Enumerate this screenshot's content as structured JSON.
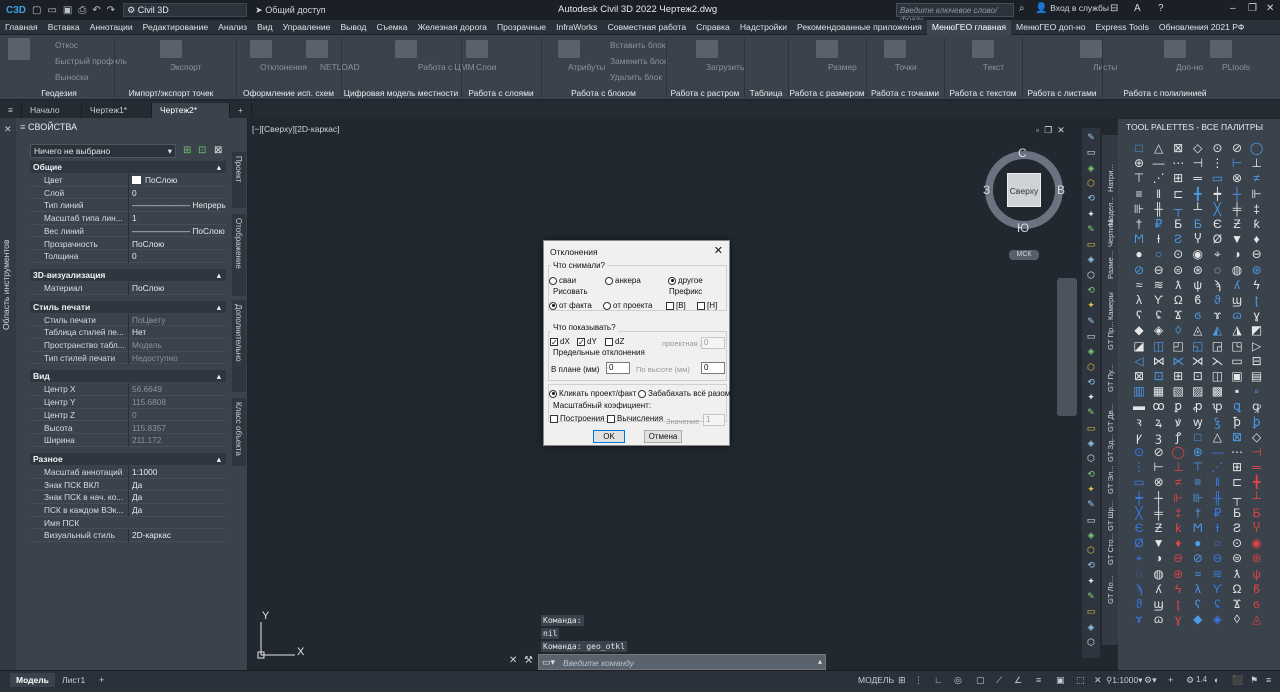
{
  "titlebar": {
    "workspace": "Civil 3D",
    "share": "Общий доступ",
    "app_title": "Autodesk Civil 3D 2022   Чертеж2.dwg",
    "search_placeholder": "Введите ключевое слово/фразу",
    "signin": "Вход в службы"
  },
  "menu": [
    "Главная",
    "Вставка",
    "Аннотации",
    "Редактирование",
    "Анализ",
    "Вид",
    "Управление",
    "Вывод",
    "Съемка",
    "Железная дорога",
    "Прозрачные",
    "InfraWorks",
    "Совместная работа",
    "Справка",
    "Надстройки",
    "Рекомендованные приложения",
    "МенюГЕО главная",
    "МенюГЕО доп-но",
    "Express Tools",
    "Обновления 2021 РФ"
  ],
  "menu_active": "МенюГЕО главная",
  "ribbon": {
    "small_buttons": [
      "Откос",
      "Быстрый профиль",
      "Выноска",
      "Экспорт",
      "Отклонения",
      "NETLOAD",
      "Работа с ЦММ",
      "Слои",
      "Вставить блок",
      "Заменить блок",
      "Удалить блок",
      "Атрибуты",
      "Загрузить",
      "Размер",
      "Точки",
      "Текст",
      "Листы",
      "Доп-но",
      "PLtools"
    ],
    "panels": [
      "Геодезия",
      "Импорт/экспорт точек",
      "Оформление исп. схем",
      "Цифровая модель местности",
      "Работа с слоями",
      "Работа с блоком",
      "Работа с растром",
      "Таблица",
      "Работа с размером",
      "Работа с точками",
      "Работа с текстом",
      "Работа с листами",
      "Работа с полилинией"
    ]
  },
  "doc_tabs": [
    "Начало",
    "Чертеж1*",
    "Чертеж2*"
  ],
  "doc_tab_active": "Чертеж2*",
  "properties": {
    "vertical_label": "Область инструментов",
    "title": "СВОЙСТВА",
    "selection": "Ничего не выбрано",
    "side_tabs": [
      "Проект",
      "Отображение",
      "Дополнительно",
      "Класс объекта"
    ],
    "sections": [
      {
        "name": "Общие",
        "rows": [
          {
            "k": "Цвет",
            "v": "ПоСлою"
          },
          {
            "k": "Слой",
            "v": "0"
          },
          {
            "k": "Тип линий",
            "v": "——————— Непрерыв..."
          },
          {
            "k": "Масштаб типа лин...",
            "v": "1"
          },
          {
            "k": "Вес линий",
            "v": "——————— ПоСлою"
          },
          {
            "k": "Прозрачность",
            "v": "ПоСлою"
          },
          {
            "k": "Толщина",
            "v": "0"
          }
        ]
      },
      {
        "name": "3D-визуализация",
        "rows": [
          {
            "k": "Материал",
            "v": "ПоСлою"
          }
        ]
      },
      {
        "name": "Стиль печати",
        "rows": [
          {
            "k": "Стиль печати",
            "v": "ПоЦвету",
            "dim": true
          },
          {
            "k": "Таблица стилей пе...",
            "v": "Нет"
          },
          {
            "k": "Пространство табл...",
            "v": "Модель",
            "dim": true
          },
          {
            "k": "Тип стилей печати",
            "v": "Недоступно",
            "dim": true
          }
        ]
      },
      {
        "name": "Вид",
        "rows": [
          {
            "k": "Центр X",
            "v": "56.6649",
            "dim": true
          },
          {
            "k": "Центр Y",
            "v": "115.6808",
            "dim": true
          },
          {
            "k": "Центр Z",
            "v": "0",
            "dim": true
          },
          {
            "k": "Высота",
            "v": "115.8357",
            "dim": true
          },
          {
            "k": "Ширина",
            "v": "211.172",
            "dim": true
          }
        ]
      },
      {
        "name": "Разное",
        "rows": [
          {
            "k": "Масштаб аннотаций",
            "v": "1:1000"
          },
          {
            "k": "Знак ПСК ВКЛ",
            "v": "Да"
          },
          {
            "k": "Знак ПСК в нач. ко...",
            "v": "Да"
          },
          {
            "k": "ПСК в каждом ВЭк...",
            "v": "Да"
          },
          {
            "k": "Имя ПСК",
            "v": ""
          },
          {
            "k": "Визуальный стиль",
            "v": "2D-каркас"
          }
        ]
      }
    ]
  },
  "viewport": {
    "label": "[−][Сверху][2D-каркас]",
    "viewcube": {
      "face": "Сверху",
      "n": "С",
      "s": "Ю",
      "w": "З",
      "e": "В",
      "ucs": "МСК"
    },
    "ucs_x": "X",
    "ucs_y": "Y"
  },
  "command": {
    "history": [
      "Команда:",
      "nil",
      "Команда: geo_otkl"
    ],
    "placeholder": "Введите команду"
  },
  "dialog": {
    "title": "Отклонения",
    "group1": "Что снимали?",
    "radios1": [
      {
        "label": "сваи",
        "on": false
      },
      {
        "label": "анкера",
        "on": false
      },
      {
        "label": "другое",
        "on": true
      }
    ],
    "draw_label": "Рисовать",
    "radios2": [
      {
        "label": "от факта",
        "on": true
      },
      {
        "label": "от проекта",
        "on": false
      }
    ],
    "prefix_label": "Префикс",
    "prefix_checks": [
      "[B]",
      "[H]"
    ],
    "group2": "Что показывать?",
    "checks": [
      {
        "label": "dX",
        "on": true
      },
      {
        "label": "dY",
        "on": true
      },
      {
        "label": "dZ",
        "on": false
      }
    ],
    "proj_z_label": "проектная Z (м)",
    "proj_z_value": "0",
    "limits_label": "Предельные отклонения",
    "plan_label": "В плане (мм)",
    "plan_value": "0",
    "height_label": "По высоте (мм)",
    "height_value": "0",
    "radios3": [
      {
        "label": "Кликать проект/факт",
        "on": true
      },
      {
        "label": "Забабахать всё разом",
        "on": false
      }
    ],
    "scale_label": "Масштабный коэфициент:",
    "checks2": [
      {
        "label": "Построения",
        "on": false
      },
      {
        "label": "Вычисления",
        "on": false
      }
    ],
    "value_label": "Значение",
    "value": "1",
    "ok": "OK",
    "cancel": "Отмена"
  },
  "tool_palettes": {
    "title": "TOOL PALETTES - ВСЕ ПАЛИТРЫ",
    "tabs": [
      "Натри...",
      "Модел...",
      "Чертить",
      "Разме...",
      "Камеры",
      "GT Пр...",
      "GT Пу...",
      "GT Дв...",
      "GT Зд...",
      "GT Эл...",
      "GT Шр...",
      "GT Сто...",
      "GT Ло..."
    ]
  },
  "statusbar": {
    "tabs": [
      "Модель",
      "Лист1"
    ],
    "active": "Модель",
    "model_label": "МОДЕЛЬ",
    "scale": "1:1000",
    "zoom": "1.4"
  }
}
